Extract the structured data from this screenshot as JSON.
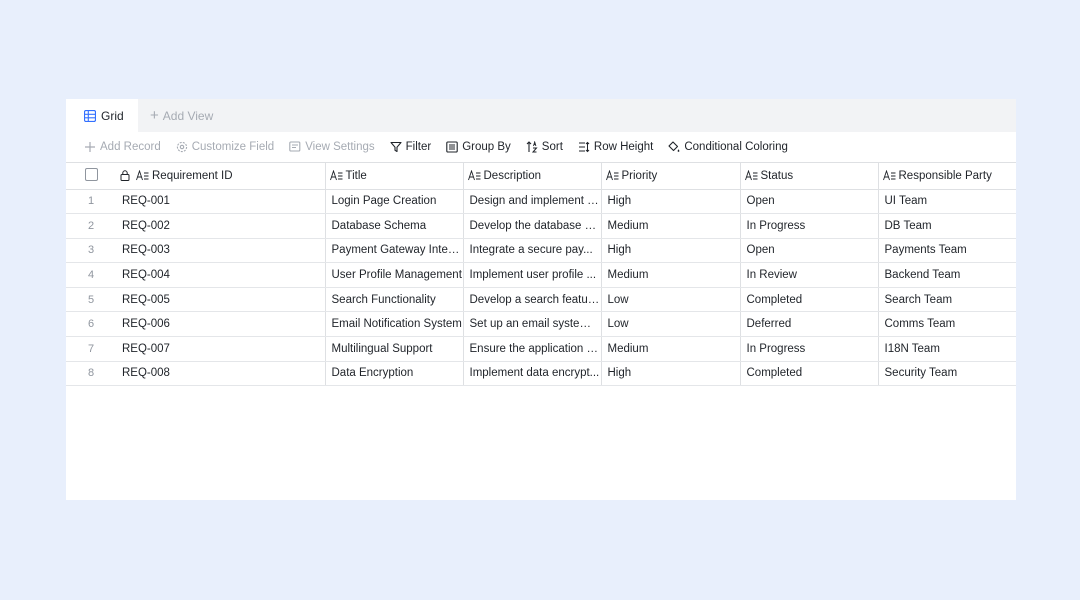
{
  "views": {
    "active_tab": "Grid",
    "add_view": "Add View"
  },
  "toolbar": {
    "add_record": "Add Record",
    "customize_field": "Customize Field",
    "view_settings": "View Settings",
    "filter": "Filter",
    "group_by": "Group By",
    "sort": "Sort",
    "row_height": "Row Height",
    "conditional_coloring": "Conditional Coloring"
  },
  "columns": [
    "Requirement ID",
    "Title",
    "Description",
    "Priority",
    "Status",
    "Responsible Party"
  ],
  "rows": [
    {
      "n": "1",
      "id": "REQ-001",
      "title": "Login Page Creation",
      "description": "Design and implement a...",
      "priority": "High",
      "status": "Open",
      "party": "UI Team"
    },
    {
      "n": "2",
      "id": "REQ-002",
      "title": "Database Schema",
      "description": "Develop the database sc...",
      "priority": "Medium",
      "status": "In Progress",
      "party": "DB Team"
    },
    {
      "n": "3",
      "id": "REQ-003",
      "title": "Payment Gateway Integ...",
      "description": "Integrate a secure pay...",
      "priority": "High",
      "status": "Open",
      "party": "Payments Team"
    },
    {
      "n": "4",
      "id": "REQ-004",
      "title": "User Profile Management",
      "description": "Implement user profile ...",
      "priority": "Medium",
      "status": "In Review",
      "party": "Backend Team"
    },
    {
      "n": "5",
      "id": "REQ-005",
      "title": "Search Functionality",
      "description": "Develop a search featur...",
      "priority": "Low",
      "status": "Completed",
      "party": "Search Team"
    },
    {
      "n": "6",
      "id": "REQ-006",
      "title": "Email Notification System",
      "description": "Set up an email system ...",
      "priority": "Low",
      "status": "Deferred",
      "party": "Comms Team"
    },
    {
      "n": "7",
      "id": "REQ-007",
      "title": "Multilingual Support",
      "description": "Ensure the application s...",
      "priority": "Medium",
      "status": "In Progress",
      "party": "I18N Team"
    },
    {
      "n": "8",
      "id": "REQ-008",
      "title": "Data Encryption",
      "description": "Implement data encrypt...",
      "priority": "High",
      "status": "Completed",
      "party": "Security Team"
    }
  ],
  "colors": {
    "page_bg": "#e8effc",
    "accent": "#3370ff",
    "disabled_text": "#a6abb3",
    "grid_line": "#dee0e3"
  }
}
